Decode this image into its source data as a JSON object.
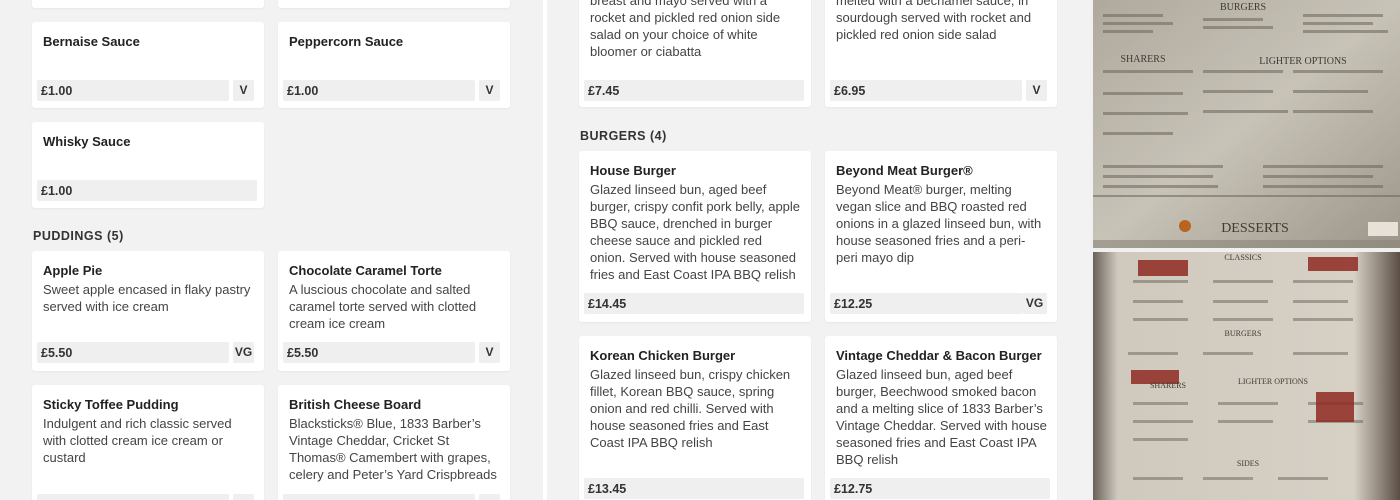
{
  "left": {
    "sauces": [
      {
        "name": "Bernaise Sauce",
        "price": "£1.00",
        "tag": "V"
      },
      {
        "name": "Peppercorn Sauce",
        "price": "£1.00",
        "tag": "V"
      },
      {
        "name": "Whisky Sauce",
        "price": "£1.00",
        "tag": ""
      }
    ],
    "puddings_heading": "PUDDINGS (5)",
    "puddings": [
      {
        "name": "Apple Pie",
        "desc": "Sweet apple encased in flaky pastry served with ice cream",
        "price": "£5.50",
        "tag": "VG"
      },
      {
        "name": "Chocolate Caramel Torte",
        "desc": "A luscious chocolate and salted caramel torte served with clotted cream ice cream",
        "price": "£5.50",
        "tag": "V"
      },
      {
        "name": "Sticky Toffee Pudding",
        "desc": "Indulgent and rich classic served with clotted cream ice cream or custard",
        "price": "",
        "tag": ""
      },
      {
        "name": "British Cheese Board",
        "desc": "Blacksticks® Blue, 1833 Barber’s Vintage Cheddar, Cricket St Thomas® Camembert with grapes, celery and Peter’s Yard Crispbreads",
        "price": "",
        "tag": ""
      }
    ]
  },
  "middle": {
    "top_cards": [
      {
        "desc": "breast and mayo served with a rocket and pickled red onion side salad on your choice of white bloomer or ciabatta",
        "price": "£7.45",
        "tag": ""
      },
      {
        "desc": "melted with a béchamel sauce, in sourdough served with rocket and pickled red onion side salad",
        "price": "£6.95",
        "tag": "V"
      }
    ],
    "burgers_heading": "BURGERS (4)",
    "burgers": [
      {
        "name": "House Burger",
        "desc": "Glazed linseed bun, aged beef burger, crispy confit pork belly, apple BBQ sauce, drenched in burger cheese sauce and pickled red onion. Served with house seasoned fries and East Coast IPA BBQ relish",
        "price": "£14.45",
        "tag": ""
      },
      {
        "name": "Beyond Meat Burger®",
        "desc": "Beyond Meat® burger, melting vegan slice and BBQ roasted red onions in a glazed linseed bun, with house seasoned fries and a peri-peri mayo dip",
        "price": "£12.25",
        "tag": "VG"
      },
      {
        "name": "Korean Chicken Burger",
        "desc": "Glazed linseed bun, crispy chicken fillet, Korean BBQ sauce, spring onion and red chilli. Served with house seasoned fries and East Coast IPA BBQ relish",
        "price": "£13.45",
        "tag": ""
      },
      {
        "name": "Vintage Cheddar & Bacon Burger",
        "desc": "Glazed linseed bun, aged beef burger, Beechwood smoked bacon and a melting slice of 1833 Barber’s Vintage Cheddar. Served with house seasoned fries and East Coast IPA BBQ relish",
        "price": "£12.75",
        "tag": ""
      }
    ]
  },
  "photos": {
    "top": {
      "headings": [
        "BURGERS",
        "SHARERS",
        "LIGHTER OPTIONS",
        "DESSERTS"
      ]
    },
    "bottom": {
      "headings": [
        "CLASSICS",
        "BURGERS",
        "SHARERS",
        "LIGHTER OPTIONS",
        "SIDES"
      ]
    }
  }
}
